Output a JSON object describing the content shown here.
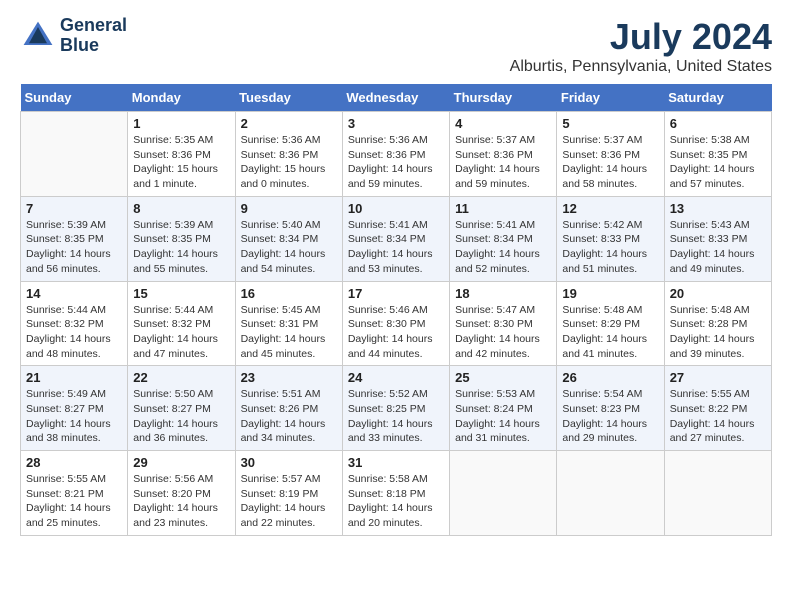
{
  "header": {
    "logo_line1": "General",
    "logo_line2": "Blue",
    "month": "July 2024",
    "location": "Alburtis, Pennsylvania, United States"
  },
  "weekdays": [
    "Sunday",
    "Monday",
    "Tuesday",
    "Wednesday",
    "Thursday",
    "Friday",
    "Saturday"
  ],
  "weeks": [
    [
      {
        "day": "",
        "sunrise": "",
        "sunset": "",
        "daylight": ""
      },
      {
        "day": "1",
        "sunrise": "Sunrise: 5:35 AM",
        "sunset": "Sunset: 8:36 PM",
        "daylight": "Daylight: 15 hours and 1 minute."
      },
      {
        "day": "2",
        "sunrise": "Sunrise: 5:36 AM",
        "sunset": "Sunset: 8:36 PM",
        "daylight": "Daylight: 15 hours and 0 minutes."
      },
      {
        "day": "3",
        "sunrise": "Sunrise: 5:36 AM",
        "sunset": "Sunset: 8:36 PM",
        "daylight": "Daylight: 14 hours and 59 minutes."
      },
      {
        "day": "4",
        "sunrise": "Sunrise: 5:37 AM",
        "sunset": "Sunset: 8:36 PM",
        "daylight": "Daylight: 14 hours and 59 minutes."
      },
      {
        "day": "5",
        "sunrise": "Sunrise: 5:37 AM",
        "sunset": "Sunset: 8:36 PM",
        "daylight": "Daylight: 14 hours and 58 minutes."
      },
      {
        "day": "6",
        "sunrise": "Sunrise: 5:38 AM",
        "sunset": "Sunset: 8:35 PM",
        "daylight": "Daylight: 14 hours and 57 minutes."
      }
    ],
    [
      {
        "day": "7",
        "sunrise": "Sunrise: 5:39 AM",
        "sunset": "Sunset: 8:35 PM",
        "daylight": "Daylight: 14 hours and 56 minutes."
      },
      {
        "day": "8",
        "sunrise": "Sunrise: 5:39 AM",
        "sunset": "Sunset: 8:35 PM",
        "daylight": "Daylight: 14 hours and 55 minutes."
      },
      {
        "day": "9",
        "sunrise": "Sunrise: 5:40 AM",
        "sunset": "Sunset: 8:34 PM",
        "daylight": "Daylight: 14 hours and 54 minutes."
      },
      {
        "day": "10",
        "sunrise": "Sunrise: 5:41 AM",
        "sunset": "Sunset: 8:34 PM",
        "daylight": "Daylight: 14 hours and 53 minutes."
      },
      {
        "day": "11",
        "sunrise": "Sunrise: 5:41 AM",
        "sunset": "Sunset: 8:34 PM",
        "daylight": "Daylight: 14 hours and 52 minutes."
      },
      {
        "day": "12",
        "sunrise": "Sunrise: 5:42 AM",
        "sunset": "Sunset: 8:33 PM",
        "daylight": "Daylight: 14 hours and 51 minutes."
      },
      {
        "day": "13",
        "sunrise": "Sunrise: 5:43 AM",
        "sunset": "Sunset: 8:33 PM",
        "daylight": "Daylight: 14 hours and 49 minutes."
      }
    ],
    [
      {
        "day": "14",
        "sunrise": "Sunrise: 5:44 AM",
        "sunset": "Sunset: 8:32 PM",
        "daylight": "Daylight: 14 hours and 48 minutes."
      },
      {
        "day": "15",
        "sunrise": "Sunrise: 5:44 AM",
        "sunset": "Sunset: 8:32 PM",
        "daylight": "Daylight: 14 hours and 47 minutes."
      },
      {
        "day": "16",
        "sunrise": "Sunrise: 5:45 AM",
        "sunset": "Sunset: 8:31 PM",
        "daylight": "Daylight: 14 hours and 45 minutes."
      },
      {
        "day": "17",
        "sunrise": "Sunrise: 5:46 AM",
        "sunset": "Sunset: 8:30 PM",
        "daylight": "Daylight: 14 hours and 44 minutes."
      },
      {
        "day": "18",
        "sunrise": "Sunrise: 5:47 AM",
        "sunset": "Sunset: 8:30 PM",
        "daylight": "Daylight: 14 hours and 42 minutes."
      },
      {
        "day": "19",
        "sunrise": "Sunrise: 5:48 AM",
        "sunset": "Sunset: 8:29 PM",
        "daylight": "Daylight: 14 hours and 41 minutes."
      },
      {
        "day": "20",
        "sunrise": "Sunrise: 5:48 AM",
        "sunset": "Sunset: 8:28 PM",
        "daylight": "Daylight: 14 hours and 39 minutes."
      }
    ],
    [
      {
        "day": "21",
        "sunrise": "Sunrise: 5:49 AM",
        "sunset": "Sunset: 8:27 PM",
        "daylight": "Daylight: 14 hours and 38 minutes."
      },
      {
        "day": "22",
        "sunrise": "Sunrise: 5:50 AM",
        "sunset": "Sunset: 8:27 PM",
        "daylight": "Daylight: 14 hours and 36 minutes."
      },
      {
        "day": "23",
        "sunrise": "Sunrise: 5:51 AM",
        "sunset": "Sunset: 8:26 PM",
        "daylight": "Daylight: 14 hours and 34 minutes."
      },
      {
        "day": "24",
        "sunrise": "Sunrise: 5:52 AM",
        "sunset": "Sunset: 8:25 PM",
        "daylight": "Daylight: 14 hours and 33 minutes."
      },
      {
        "day": "25",
        "sunrise": "Sunrise: 5:53 AM",
        "sunset": "Sunset: 8:24 PM",
        "daylight": "Daylight: 14 hours and 31 minutes."
      },
      {
        "day": "26",
        "sunrise": "Sunrise: 5:54 AM",
        "sunset": "Sunset: 8:23 PM",
        "daylight": "Daylight: 14 hours and 29 minutes."
      },
      {
        "day": "27",
        "sunrise": "Sunrise: 5:55 AM",
        "sunset": "Sunset: 8:22 PM",
        "daylight": "Daylight: 14 hours and 27 minutes."
      }
    ],
    [
      {
        "day": "28",
        "sunrise": "Sunrise: 5:55 AM",
        "sunset": "Sunset: 8:21 PM",
        "daylight": "Daylight: 14 hours and 25 minutes."
      },
      {
        "day": "29",
        "sunrise": "Sunrise: 5:56 AM",
        "sunset": "Sunset: 8:20 PM",
        "daylight": "Daylight: 14 hours and 23 minutes."
      },
      {
        "day": "30",
        "sunrise": "Sunrise: 5:57 AM",
        "sunset": "Sunset: 8:19 PM",
        "daylight": "Daylight: 14 hours and 22 minutes."
      },
      {
        "day": "31",
        "sunrise": "Sunrise: 5:58 AM",
        "sunset": "Sunset: 8:18 PM",
        "daylight": "Daylight: 14 hours and 20 minutes."
      },
      {
        "day": "",
        "sunrise": "",
        "sunset": "",
        "daylight": ""
      },
      {
        "day": "",
        "sunrise": "",
        "sunset": "",
        "daylight": ""
      },
      {
        "day": "",
        "sunrise": "",
        "sunset": "",
        "daylight": ""
      }
    ]
  ]
}
